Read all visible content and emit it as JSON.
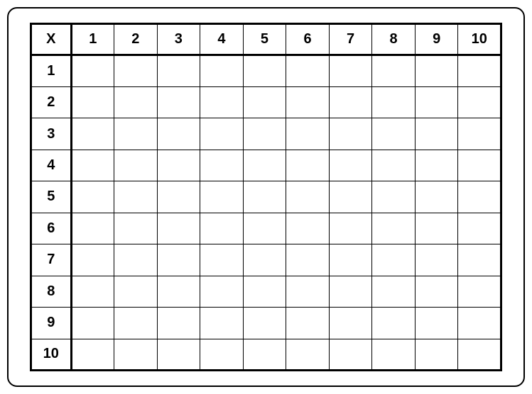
{
  "chart_data": {
    "type": "table",
    "title": "",
    "corner_label": "X",
    "column_headers": [
      "1",
      "2",
      "3",
      "4",
      "5",
      "6",
      "7",
      "8",
      "9",
      "10"
    ],
    "row_headers": [
      "1",
      "2",
      "3",
      "4",
      "5",
      "6",
      "7",
      "8",
      "9",
      "10"
    ],
    "cells": [
      [
        "",
        "",
        "",
        "",
        "",
        "",
        "",
        "",
        "",
        ""
      ],
      [
        "",
        "",
        "",
        "",
        "",
        "",
        "",
        "",
        "",
        ""
      ],
      [
        "",
        "",
        "",
        "",
        "",
        "",
        "",
        "",
        "",
        ""
      ],
      [
        "",
        "",
        "",
        "",
        "",
        "",
        "",
        "",
        "",
        ""
      ],
      [
        "",
        "",
        "",
        "",
        "",
        "",
        "",
        "",
        "",
        ""
      ],
      [
        "",
        "",
        "",
        "",
        "",
        "",
        "",
        "",
        "",
        ""
      ],
      [
        "",
        "",
        "",
        "",
        "",
        "",
        "",
        "",
        "",
        ""
      ],
      [
        "",
        "",
        "",
        "",
        "",
        "",
        "",
        "",
        "",
        ""
      ],
      [
        "",
        "",
        "",
        "",
        "",
        "",
        "",
        "",
        "",
        ""
      ],
      [
        "",
        "",
        "",
        "",
        "",
        "",
        "",
        "",
        "",
        ""
      ]
    ]
  }
}
